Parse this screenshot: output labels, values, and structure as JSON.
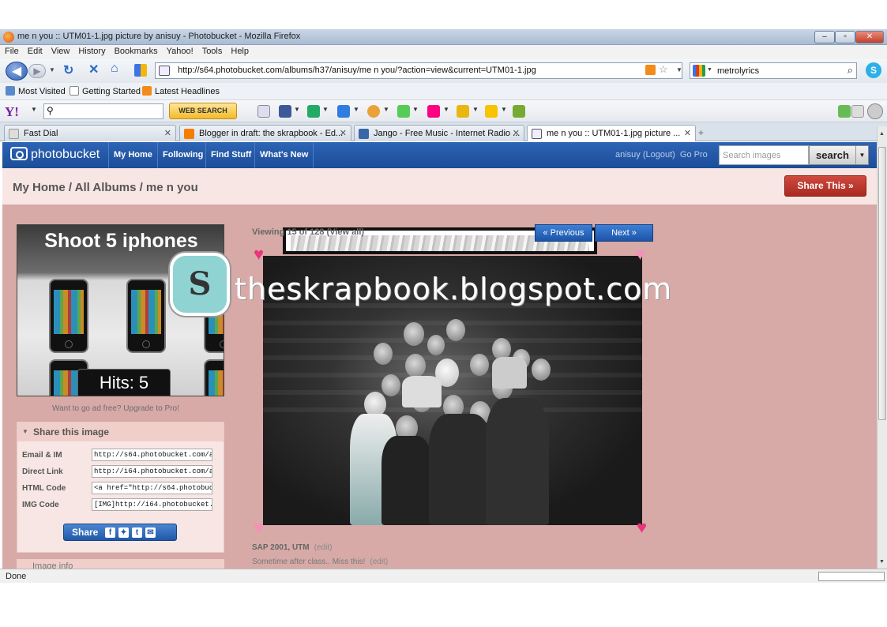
{
  "window": {
    "title": "me n you :: UTM01-1.jpg picture by anisuy - Photobucket - Mozilla Firefox",
    "minimize": "–",
    "maximize": "▫",
    "close": "✕"
  },
  "menu": [
    "File",
    "Edit",
    "View",
    "History",
    "Bookmarks",
    "Yahoo!",
    "Tools",
    "Help"
  ],
  "nav": {
    "url": "http://s64.photobucket.com/albums/h37/anisuy/me n you/?action=view&current=UTM01-1.jpg",
    "search_engine_text": "metrolyrics"
  },
  "bookmarks": [
    "Most Visited",
    "Getting Started",
    "Latest Headlines"
  ],
  "yahoo": {
    "logo": "Y!",
    "web_search": "WEB SEARCH"
  },
  "tabs": [
    {
      "label": "Fast Dial",
      "active": false
    },
    {
      "label": "Blogger in draft: the skrapbook - Ed...",
      "active": false
    },
    {
      "label": "Jango - Free Music - Internet Radio ...",
      "active": false
    },
    {
      "label": "me n you :: UTM01-1.jpg picture ...",
      "active": true
    }
  ],
  "photobucket": {
    "logo": "photobucket",
    "nav": [
      "My Home",
      "Following",
      "Find Stuff",
      "What's New"
    ],
    "user": "anisuy",
    "logout": "(Logout)",
    "go_pro": "Go Pro",
    "search_placeholder": "Search images",
    "search_button": "search",
    "breadcrumb": "My Home / All Albums / me n you",
    "share_this": "Share This »"
  },
  "ad": {
    "title": "Shoot 5 iphones",
    "hits": "Hits: 5",
    "go_ad_free": "Want to go ad free? Upgrade to Pro!"
  },
  "share_panel": {
    "heading": "Share this image",
    "rows": [
      {
        "label": "Email & IM",
        "value": "http://s64.photobucket.com/albums/h"
      },
      {
        "label": "Direct Link",
        "value": "http://i64.photobucket.com/albums/h"
      },
      {
        "label": "HTML Code",
        "value": "<a href=\"http://s64.photobucket.com"
      },
      {
        "label": "IMG Code",
        "value": "[IMG]http://i64.photobucket.com/alb"
      }
    ],
    "share_button": "Share",
    "image_info": "Image info"
  },
  "viewer": {
    "viewing_text": "Viewing 15 of 128 (View all)",
    "previous": "« Previous",
    "next": "Next »",
    "watermark": "theskrapbook.blogspot.com",
    "watermark_logo": "S",
    "caption_title": "SAP 2001, UTM",
    "caption_edit": "(edit)",
    "description": "Sometime after class.. Miss this!",
    "description_edit": "(edit)"
  },
  "status": {
    "text": "Done"
  },
  "colors": {
    "page_bg": "#d7aaa7",
    "pb_blue": "#1b4d98",
    "share_red": "#a92a21",
    "heart": "#e8357c"
  }
}
